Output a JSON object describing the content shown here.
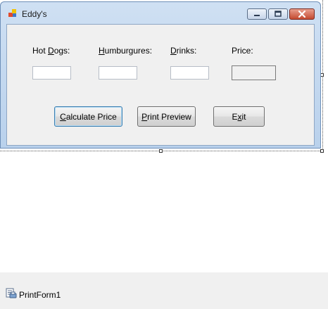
{
  "form": {
    "title": "Eddy's",
    "caption_buttons": [
      "minimize",
      "maximize",
      "close"
    ],
    "colors": {
      "titlebar": "#b9d1ec",
      "close_button": "#c44a30",
      "client": "#f0f0f0"
    }
  },
  "labels": [
    {
      "text": "Hot Dogs:",
      "access_key": "D"
    },
    {
      "text": "Humburgures:",
      "access_key": "H"
    },
    {
      "text": "Drinks:",
      "access_key": "D"
    },
    {
      "text": "Price:",
      "access_key": ""
    }
  ],
  "inputs": {
    "hot_dogs": "",
    "humburgures": "",
    "drinks": "",
    "price": ""
  },
  "buttons": {
    "calculate_price": "Calculate Price",
    "print_preview": "Print Preview",
    "exit": "Exit"
  },
  "tray": {
    "component": "PrintForm1",
    "icon": "printform-icon"
  }
}
